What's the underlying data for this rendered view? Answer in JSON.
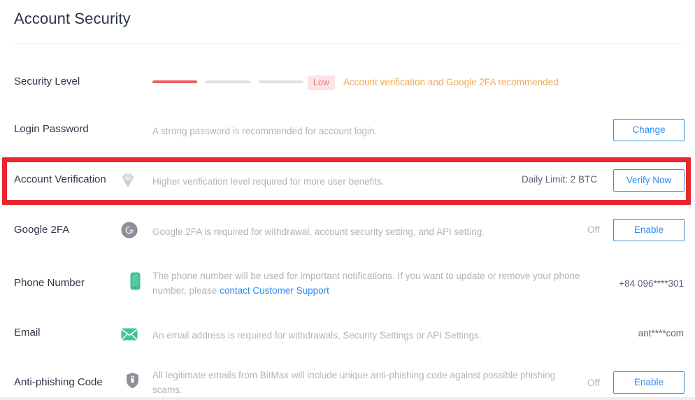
{
  "header": {
    "title": "Account Security"
  },
  "security_level": {
    "label": "Security Level",
    "bars_total": 3,
    "bars_filled": 1,
    "badge": "Low",
    "note": "Account verification and Google 2FA recommended",
    "colors": {
      "filled_bar": "#f05b5b",
      "empty_bar": "#e2e2e2",
      "badge_bg": "#fde3e3",
      "badge_text": "#ef7878",
      "note_text": "#eeaa55"
    }
  },
  "rows": [
    {
      "key": "login-password",
      "label": "Login Password",
      "icon": null,
      "description": "A strong password is recommended for account login.",
      "value": "",
      "status": "",
      "button": "Change"
    },
    {
      "key": "account-verification",
      "label": "Account Verification",
      "icon": "gem-v1-icon",
      "description": "Higher verification level required for more user benefits.",
      "value": "Daily Limit: 2 BTC",
      "status": "",
      "button": "Verify Now",
      "highlighted": true
    },
    {
      "key": "google-2fa",
      "label": "Google 2FA",
      "icon": "google-icon",
      "description": "Google 2FA is required for withdrawal, account security setting, and API setting.",
      "value": "",
      "status": "Off",
      "button": "Enable"
    },
    {
      "key": "phone-number",
      "label": "Phone Number",
      "icon": "phone-icon",
      "description_part1": "The phone number will be used for important notifications. If you want to update or remove your phone number, please ",
      "description_link": "contact Customer Support",
      "value": "+84 096****301",
      "status": "",
      "button": null
    },
    {
      "key": "email",
      "label": "Email",
      "icon": "mail-icon",
      "description": "An email address is required for withdrawals, Security Settings or API Settings.",
      "value": "ant****com",
      "status": "",
      "button": null
    },
    {
      "key": "anti-phishing-code",
      "label": "Anti-phishing Code",
      "icon": "shield-icon",
      "description": "All legitimate emails from BitMax will include unique anti-phishing code against possible phishing scams.",
      "value": "",
      "status": "Off",
      "button": "Enable"
    }
  ],
  "theme": {
    "button_border": "#3c8fd6",
    "button_text": "#2d8cf0",
    "link": "#2d8cf0",
    "label_text": "#2e3648",
    "description_text": "#b0b4bb",
    "highlight_border": "#e8262b"
  }
}
